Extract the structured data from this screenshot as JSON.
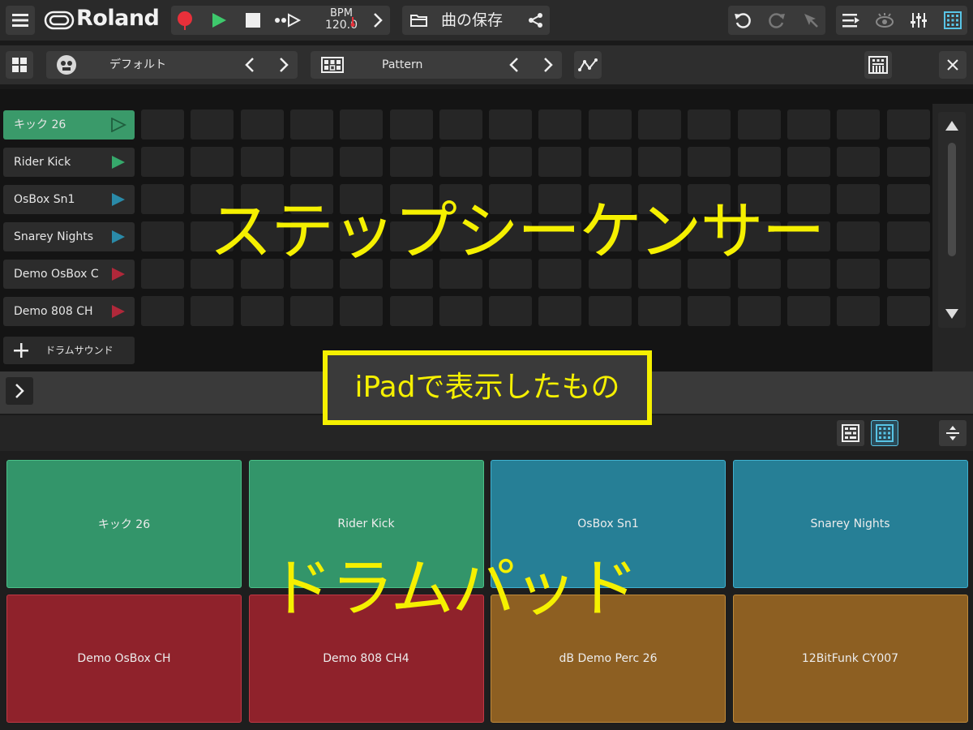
{
  "app": {
    "brand": "Roland",
    "bpm_label": "BPM",
    "bpm_value": "120.0",
    "save_label": "曲の保存"
  },
  "toolbar2": {
    "kit_name": "デフォルト",
    "pattern_name": "Pattern"
  },
  "tracks": [
    {
      "label": "キック 26",
      "selected": true,
      "play_color": "#2b7a51"
    },
    {
      "label": "Rider Kick",
      "selected": false,
      "play_color": "#36a86b"
    },
    {
      "label": "OsBox Sn1",
      "selected": false,
      "play_color": "#2a8aa8"
    },
    {
      "label": "Snarey Nights",
      "selected": false,
      "play_color": "#2a8aa8"
    },
    {
      "label": "Demo OsBox C",
      "selected": false,
      "play_color": "#b0283a"
    },
    {
      "label": "Demo 808 CH",
      "selected": false,
      "play_color": "#b0283a"
    }
  ],
  "add_drum_label": "ドラムサウンド",
  "pads": [
    {
      "label": "キック 26",
      "color": "#33956a",
      "border": "#4ac087"
    },
    {
      "label": "Rider Kick",
      "color": "#33956a",
      "border": "#4ac087"
    },
    {
      "label": "OsBox Sn1",
      "color": "#267f96",
      "border": "#3fb1d0"
    },
    {
      "label": "Snarey Nights",
      "color": "#267f96",
      "border": "#3fb1d0"
    },
    {
      "label": "Demo OsBox CH",
      "color": "#8f222b",
      "border": "#c23845"
    },
    {
      "label": "Demo 808 CH4",
      "color": "#8f222b",
      "border": "#c23845"
    },
    {
      "label": "dB Demo Perc 26",
      "color": "#8d5f22",
      "border": "#c08a3a"
    },
    {
      "label": "12BitFunk CY007",
      "color": "#8d5f22",
      "border": "#c08a3a"
    }
  ],
  "annotations": {
    "sequencer": "ステップシーケンサー",
    "device": "iPadで表示したもの",
    "pads": "ドラムパッド"
  },
  "colors": {
    "record": "#e8303a",
    "play": "#3ec86c",
    "accent": "#58c4e6",
    "annotation": "#f5f000"
  }
}
